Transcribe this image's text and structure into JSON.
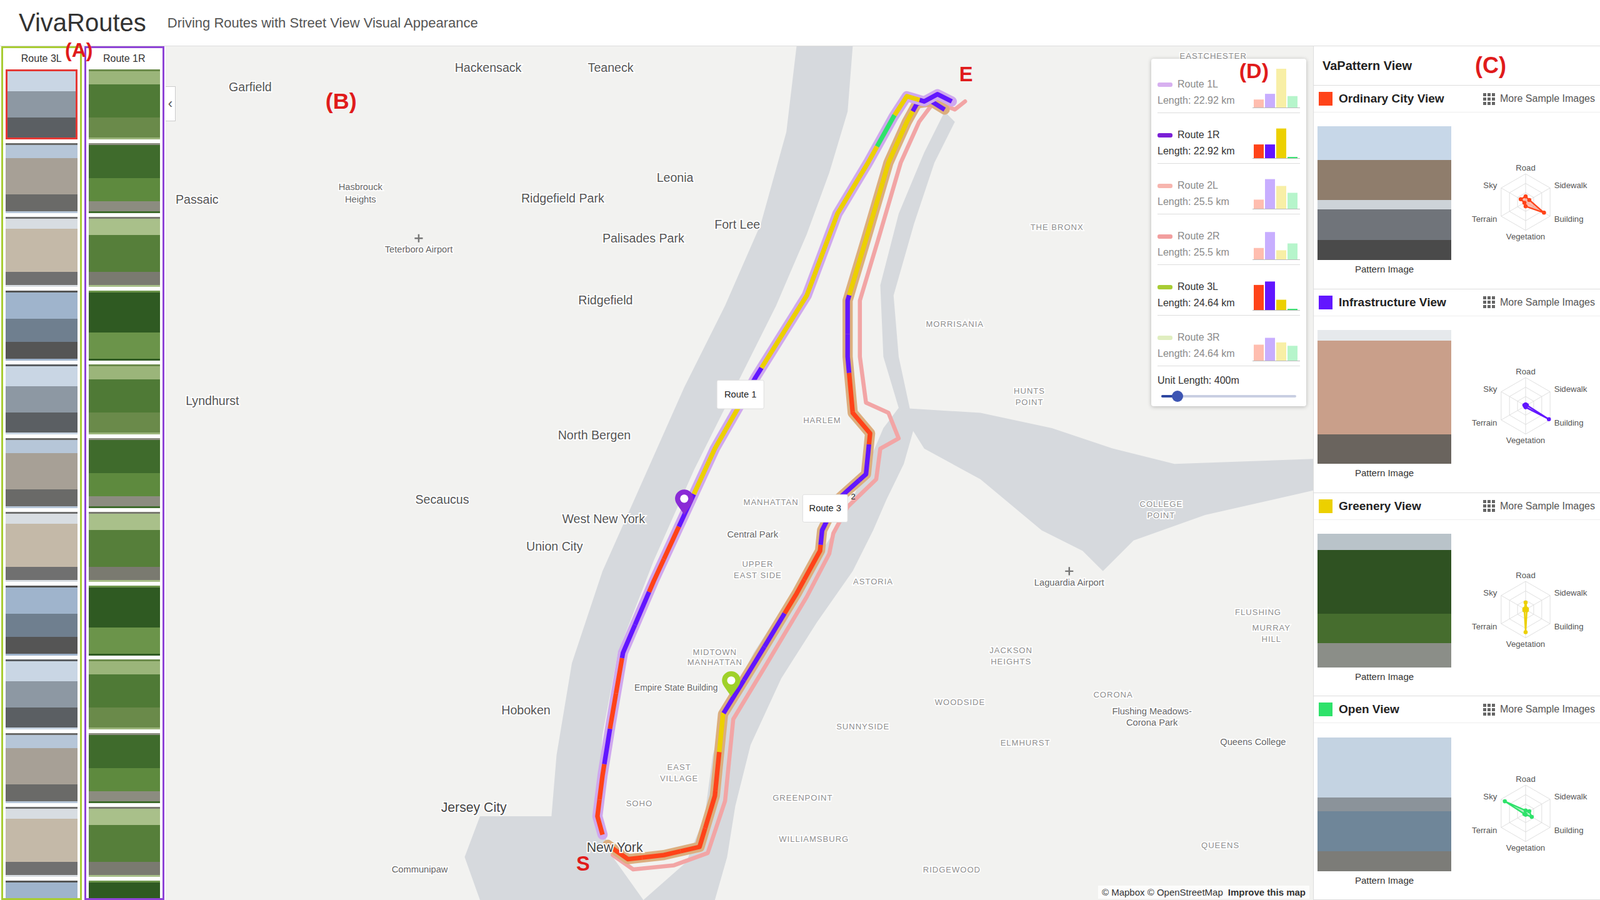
{
  "header": {
    "title": "VivaRoutes",
    "subtitle": "Driving Routes with Street View Visual Appearance"
  },
  "annotations": {
    "a": "(A)",
    "b": "(B)",
    "c": "(C)",
    "d": "(D)",
    "e": "E",
    "s": "S"
  },
  "strip": {
    "columns": [
      {
        "title": "Route 3L",
        "color": "#a8cc34",
        "kind": "street",
        "thumbnails": [
          {
            "selected": true
          },
          {
            "selected": false
          },
          {
            "selected": false
          },
          {
            "selected": false
          },
          {
            "selected": false
          },
          {
            "selected": false
          },
          {
            "selected": false
          },
          {
            "selected": false
          },
          {
            "selected": false
          },
          {
            "selected": false
          },
          {
            "selected": false
          },
          {
            "selected": false
          }
        ]
      },
      {
        "title": "Route 1R",
        "color": "#8e44d6",
        "kind": "park",
        "thumbnails": [
          {
            "selected": false
          },
          {
            "selected": false
          },
          {
            "selected": false
          },
          {
            "selected": false
          },
          {
            "selected": false
          },
          {
            "selected": false
          },
          {
            "selected": false
          },
          {
            "selected": false
          },
          {
            "selected": false
          },
          {
            "selected": false
          },
          {
            "selected": false
          },
          {
            "selected": false
          }
        ]
      }
    ]
  },
  "map": {
    "collapse": "‹",
    "labels": [
      "Garfield",
      "Hackensack",
      "Teaneck",
      "Passaic",
      "Hasbrouck",
      "Heights",
      "Teterboro Airport",
      "Leonia",
      "Ridgefield Park",
      "Fort Lee",
      "Palisades Park",
      "Ridgefield",
      "Lyndhurst",
      "North Bergen",
      "Secaucus",
      "West New York",
      "Union City",
      "Hoboken",
      "Jersey City",
      "Communipaw",
      "HARLEM",
      "MANHATTAN",
      "Central Park",
      "UPPER",
      "EAST SIDE",
      "MIDTOWN",
      "MANHATTAN",
      "Empire State Building",
      "EAST",
      "VILLAGE",
      "SOHO",
      "New York",
      "WILLIAMSBURG",
      "GREENPOINT",
      "SUNNYSIDE",
      "ASTORIA",
      "WOODSIDE",
      "JACKSON",
      "HEIGHTS",
      "Laguardia Airport",
      "THE BRONX",
      "MORRISANIA",
      "HUNTS",
      "POINT",
      "COLLEGE",
      "POINT",
      "FLUSHING",
      "MURRAY",
      "HILL",
      "ELMHURST",
      "CORONA",
      "Flushing Meadows-",
      "Corona Park",
      "Queens College",
      "QUEENS",
      "RIDGEWOOD",
      "EASTCHESTER"
    ],
    "routes": [
      {
        "label": "Route 1",
        "outline": "#cfa8ee",
        "segments": [
          0,
          0,
          1,
          0,
          0,
          1,
          1,
          0,
          0,
          1,
          2,
          2,
          2,
          1,
          2,
          2,
          2,
          2,
          2,
          2,
          2,
          3,
          2,
          1
        ]
      },
      {
        "label": "Route 3",
        "outline": "#dcae7e",
        "segments": [
          0,
          0,
          0,
          0,
          0,
          2,
          1,
          1,
          1,
          0,
          0,
          1,
          1,
          1,
          0,
          0,
          1,
          1,
          2,
          2,
          2,
          2,
          2,
          1
        ]
      },
      {
        "label": "2",
        "outline": "#f2a5a5",
        "segments": []
      }
    ],
    "pins": [
      {
        "color": "#8a2bd6"
      },
      {
        "color": "#9fd12a"
      }
    ],
    "attribution": "© Mapbox © OpenStreetMap",
    "improve": "Improve this map"
  },
  "legend": {
    "entries": [
      {
        "name": "Route 1L",
        "length": "Length: 22.92 km",
        "color": "#d7b0f0",
        "selected": false,
        "bars": [
          7,
          12,
          34,
          10
        ]
      },
      {
        "name": "Route 1R",
        "length": "Length: 22.92 km",
        "color": "#7b1fd6",
        "selected": true,
        "bars": [
          12,
          12,
          26,
          1
        ]
      },
      {
        "name": "Route 2L",
        "length": "Length: 25.5 km",
        "color": "#f7b5ae",
        "selected": false,
        "bars": [
          8,
          26,
          20,
          14
        ]
      },
      {
        "name": "Route 2R",
        "length": "Length: 25.5 km",
        "color": "#f29e9e",
        "selected": false,
        "bars": [
          10,
          24,
          8,
          14
        ]
      },
      {
        "name": "Route 3L",
        "length": "Length: 24.64 km",
        "color": "#a8cc34",
        "selected": true,
        "bars": [
          22,
          25,
          9,
          1
        ]
      },
      {
        "name": "Route 3R",
        "length": "Length: 24.64 km",
        "color": "#e0eec0",
        "selected": false,
        "bars": [
          14,
          20,
          16,
          13
        ]
      }
    ],
    "unit": "Unit Length: 400m",
    "level": 0.12
  },
  "patterns": {
    "title": "VaPattern View",
    "items": [
      {
        "name": "Ordinary City View",
        "color": "#ff4319",
        "more": "More Sample Images",
        "caption": "Pattern Image",
        "axes": [
          "Road",
          "Sidewalk",
          "Building",
          "Vegetation",
          "Terrain",
          "Sky"
        ],
        "values": [
          0.2,
          0.15,
          0.75,
          0.15,
          0.05,
          0.2
        ]
      },
      {
        "name": "Infrastructure View",
        "color": "#6216ff",
        "more": "More Sample Images",
        "caption": "Pattern Image",
        "axes": [
          "Road",
          "Sidewalk",
          "Building",
          "Vegetation",
          "Terrain",
          "Sky"
        ],
        "values": [
          0.05,
          0.05,
          0.95,
          0.05,
          0.02,
          0.05
        ]
      },
      {
        "name": "Greenery View",
        "color": "#ecd000",
        "more": "More Sample Images",
        "caption": "Pattern Image",
        "axes": [
          "Road",
          "Sidewalk",
          "Building",
          "Vegetation",
          "Terrain",
          "Sky"
        ],
        "values": [
          0.25,
          0.05,
          0.05,
          0.8,
          0.05,
          0.05
        ]
      },
      {
        "name": "Open View",
        "color": "#2ee26a",
        "more": "More Sample Images",
        "caption": "Pattern Image",
        "axes": [
          "Road",
          "Sidewalk",
          "Building",
          "Vegetation",
          "Terrain",
          "Sky"
        ],
        "values": [
          0.1,
          0.15,
          0.25,
          0.05,
          0.05,
          0.85
        ]
      }
    ]
  }
}
